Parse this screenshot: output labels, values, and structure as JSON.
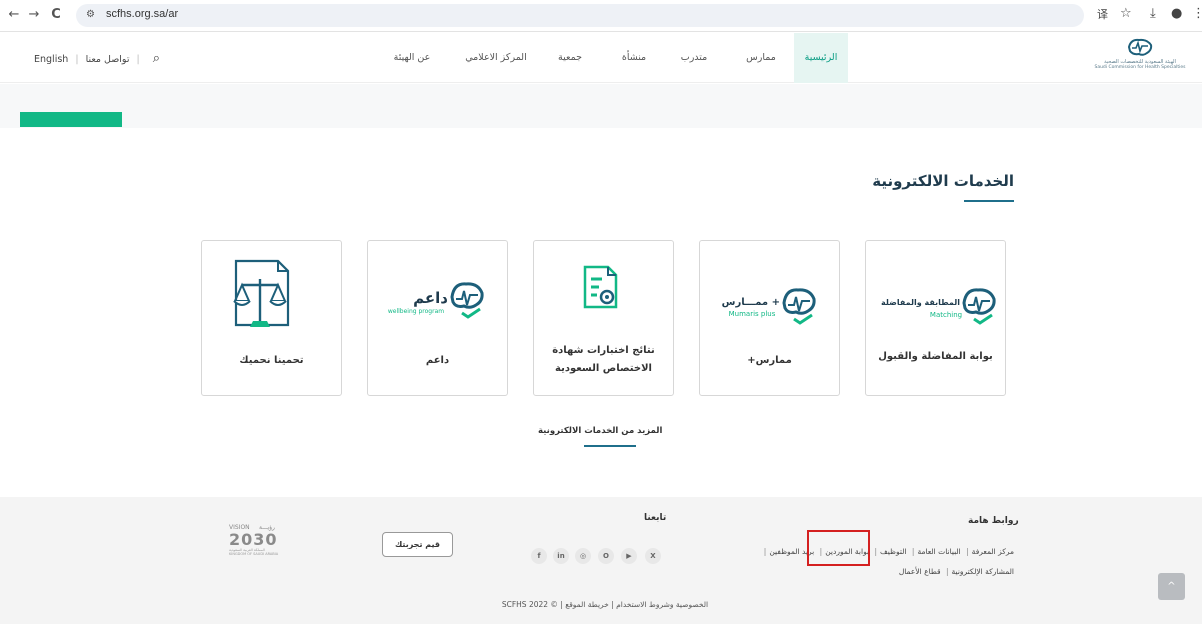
{
  "browser": {
    "url": "scfhs.org.sa/ar",
    "back": "←",
    "forward": "→",
    "reload": "C",
    "tune": "⚙",
    "translate_icon": "译",
    "star_icon": "☆",
    "download_icon": "⤓",
    "profile_icon": "●",
    "menu_icon": "⋮"
  },
  "logo": {
    "line1": "الهيئة السعودية للتخصصات الصحية",
    "line2": "Saudi Commission for Health Specialties"
  },
  "nav": {
    "items": [
      "الرئيسية",
      "ممارس",
      "متدرب",
      "منشأة",
      "جمعية",
      "المركز الاعلامي",
      "عن الهيئة"
    ],
    "english": "English",
    "contact": "تواصل معنا",
    "search_icon": "⌕"
  },
  "section": {
    "title": "الخدمات الالكترونية"
  },
  "cards": [
    {
      "label": "بوابة المفاضلة والقبول",
      "logo_text": "المطابقة والمفاضلة",
      "logo_sub": "Matching"
    },
    {
      "label": "ممارس+",
      "logo_text": "ممـــارس +",
      "logo_sub": "Mumaris plus"
    },
    {
      "label_l1": "نتائج اختبارات شهادة",
      "label_l2": "الاختصاص السعودية"
    },
    {
      "label": "داعم",
      "logo_text": "داعم",
      "logo_sub": "wellbeing program"
    },
    {
      "label": "تحمينا نحميك"
    }
  ],
  "more_services": "المزيد من الخدمات الالكترونية",
  "footer": {
    "links_title": "روابط هامة",
    "links_row1": [
      "مركز المعرفة",
      "البيانات العامة",
      "التوظيف",
      "بوابة الموردين",
      "بريد الموظفين"
    ],
    "links_row2": [
      "المشاركة الإلكترونية",
      "قطاع الأعمال"
    ],
    "follow_title": "تابعنا",
    "social": [
      "f",
      "in",
      "◎",
      "O",
      "▶",
      "X"
    ],
    "feedback": "قيم تجربتك",
    "vision_ar": "رؤيـــة",
    "vision_en": "VISION",
    "vision_year": "2030",
    "vision_country": "المملكة العربية السعودية",
    "vision_country_en": "KINGDOM OF SAUDI ARABIA",
    "copyright": "الخصوصية وشروط الاستخدام | خريطة الموقع | © SCFHS 2022",
    "scroll_top": "^"
  }
}
